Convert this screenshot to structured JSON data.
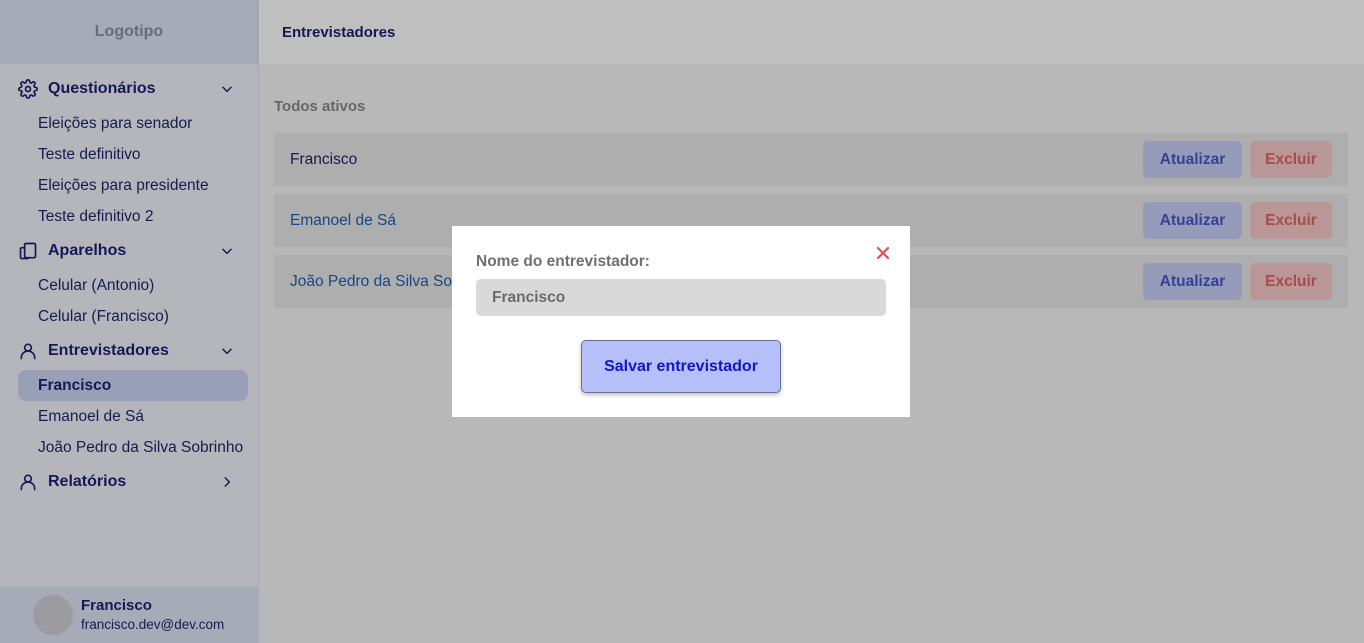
{
  "logo": "Logotipo",
  "sidebar": {
    "sections": [
      {
        "title": "Questionários",
        "icon": "gear-icon",
        "items": [
          "Eleições para senador",
          "Teste definitivo",
          "Eleições para presidente",
          "Teste definitivo 2"
        ]
      },
      {
        "title": "Aparelhos",
        "icon": "devices-icon",
        "items": [
          "Celular (Antonio)",
          "Celular (Francisco)"
        ]
      },
      {
        "title": "Entrevistadores",
        "icon": "user-icon",
        "items": [
          "Francisco",
          "Emanoel de Sá",
          "João Pedro da Silva Sobrinho"
        ],
        "active_item": "Francisco"
      },
      {
        "title": "Relatórios",
        "icon": "user-icon",
        "items": []
      }
    ]
  },
  "user": {
    "name": "Francisco",
    "email": "francisco.dev@dev.com"
  },
  "topbar": {
    "title": "Entrevistadores"
  },
  "main": {
    "list_heading": "Todos ativos",
    "rows": [
      {
        "name": "Francisco",
        "update_label": "Atualizar",
        "delete_label": "Excluir"
      },
      {
        "name": "Emanoel de Sá",
        "update_label": "Atualizar",
        "delete_label": "Excluir"
      },
      {
        "name": "João Pedro da Silva Sobrinho",
        "update_label": "Atualizar",
        "delete_label": "Excluir"
      }
    ]
  },
  "modal": {
    "label": "Nome do entrevistador:",
    "input_value": "Francisco",
    "save_label": "Salvar entrevistador"
  },
  "colors": {
    "primary_text": "#1f1f75",
    "update_bg": "#c9cff7",
    "delete_bg": "#f9caca",
    "save_bg": "#b5c0fb",
    "close_red": "#e05050"
  }
}
